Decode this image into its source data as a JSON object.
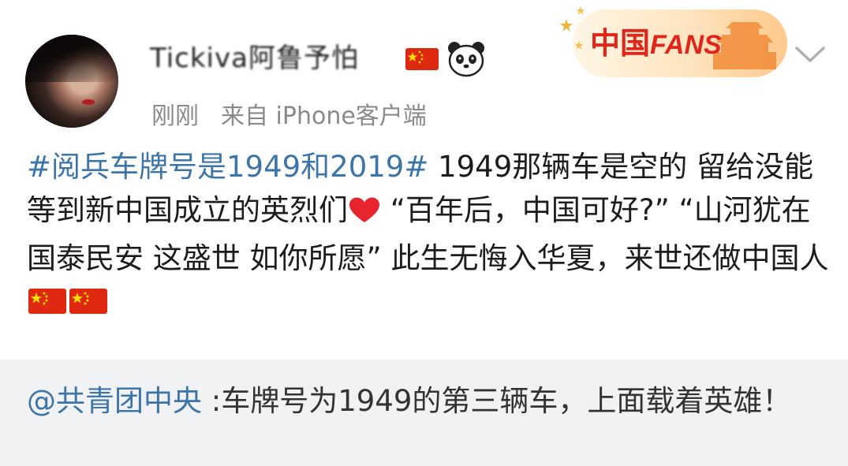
{
  "post": {
    "username": "Tickiva阿鲁予怕",
    "time": "刚刚",
    "source_prefix": "来自",
    "source_device": "iPhone客户端",
    "name_emojis": [
      "flag-china-icon",
      "panda-icon"
    ],
    "badge": {
      "text": "中国FANS"
    },
    "content": {
      "hashtag": "#阅兵车牌号是1949和2019#",
      "line1": " 1949那辆车是空的 留给没能等到新中国成立的英烈们",
      "line2": " “百年后，中国可好?” “山河犹在 国泰民安 这盛世 如你所愿” 此生无悔入华夏，来世还做中国人"
    }
  },
  "repost": {
    "mention": "@共青团中央",
    "text": " :车牌号为1949的第三辆车，上面载着英雄！"
  },
  "colors": {
    "link_blue": "#3e75a8",
    "meta_gray": "#8a8a8a",
    "repost_bg": "#f1f2f4",
    "flag_red": "#de2910",
    "flag_yellow": "#ffde00"
  }
}
